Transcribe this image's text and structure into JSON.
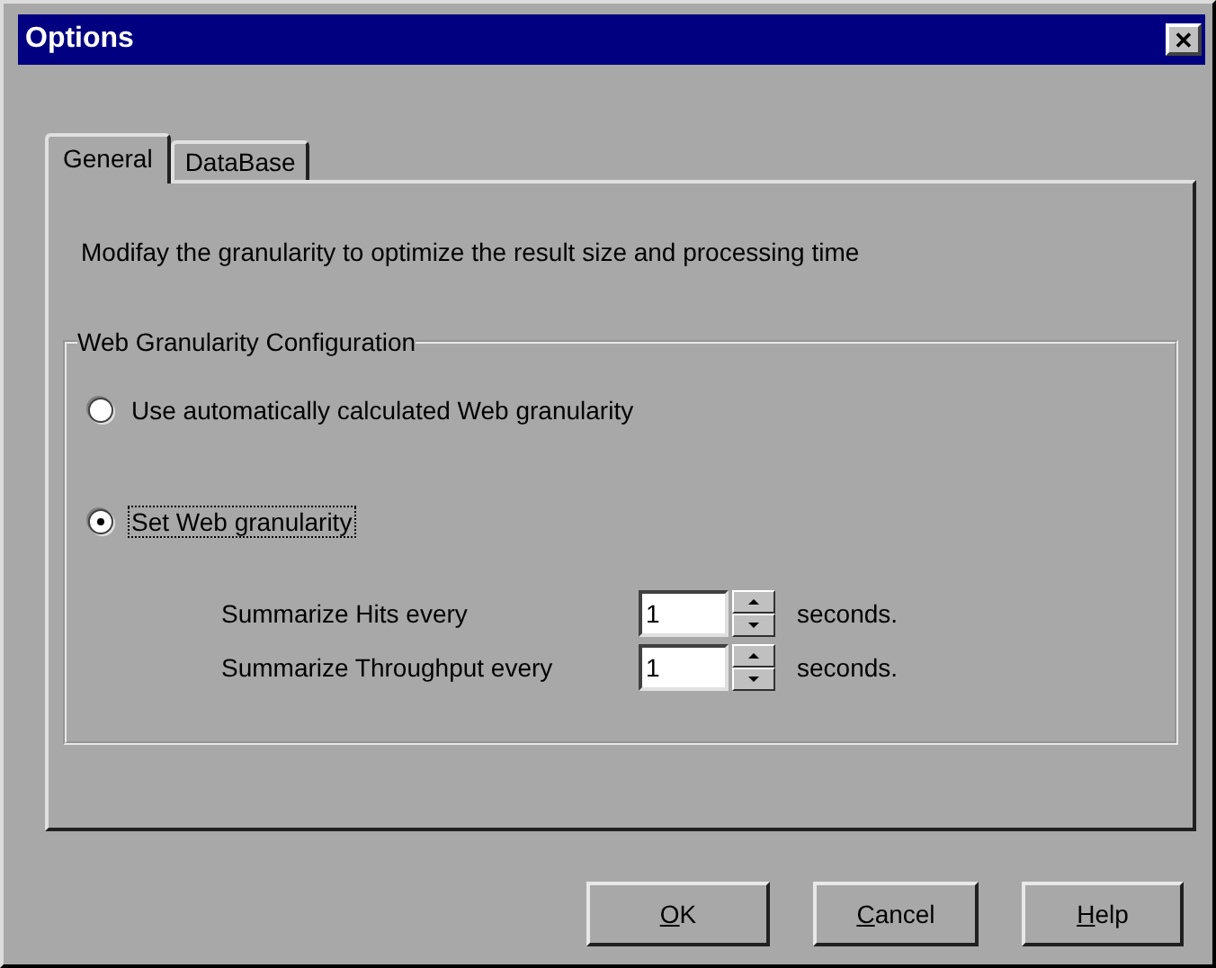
{
  "window": {
    "title": "Options",
    "close": "✕"
  },
  "tabs": [
    {
      "label": "General",
      "selected": true
    },
    {
      "label": "DataBase",
      "selected": false
    }
  ],
  "description": "Modifay the granularity to optimize the result size and processing time",
  "group": {
    "title": "Web Granularity Configuration",
    "options": [
      {
        "label": "Use automatically calculated Web granularity",
        "selected": false,
        "focused": false
      },
      {
        "label": "Set Web granularity",
        "selected": true,
        "focused": true
      }
    ],
    "settings": [
      {
        "label": "Summarize Hits every",
        "value": "1",
        "unit": "seconds."
      },
      {
        "label": "Summarize Throughput every",
        "value": "1",
        "unit": "seconds."
      }
    ]
  },
  "buttons": [
    "OK",
    "Cancel",
    "Help"
  ]
}
